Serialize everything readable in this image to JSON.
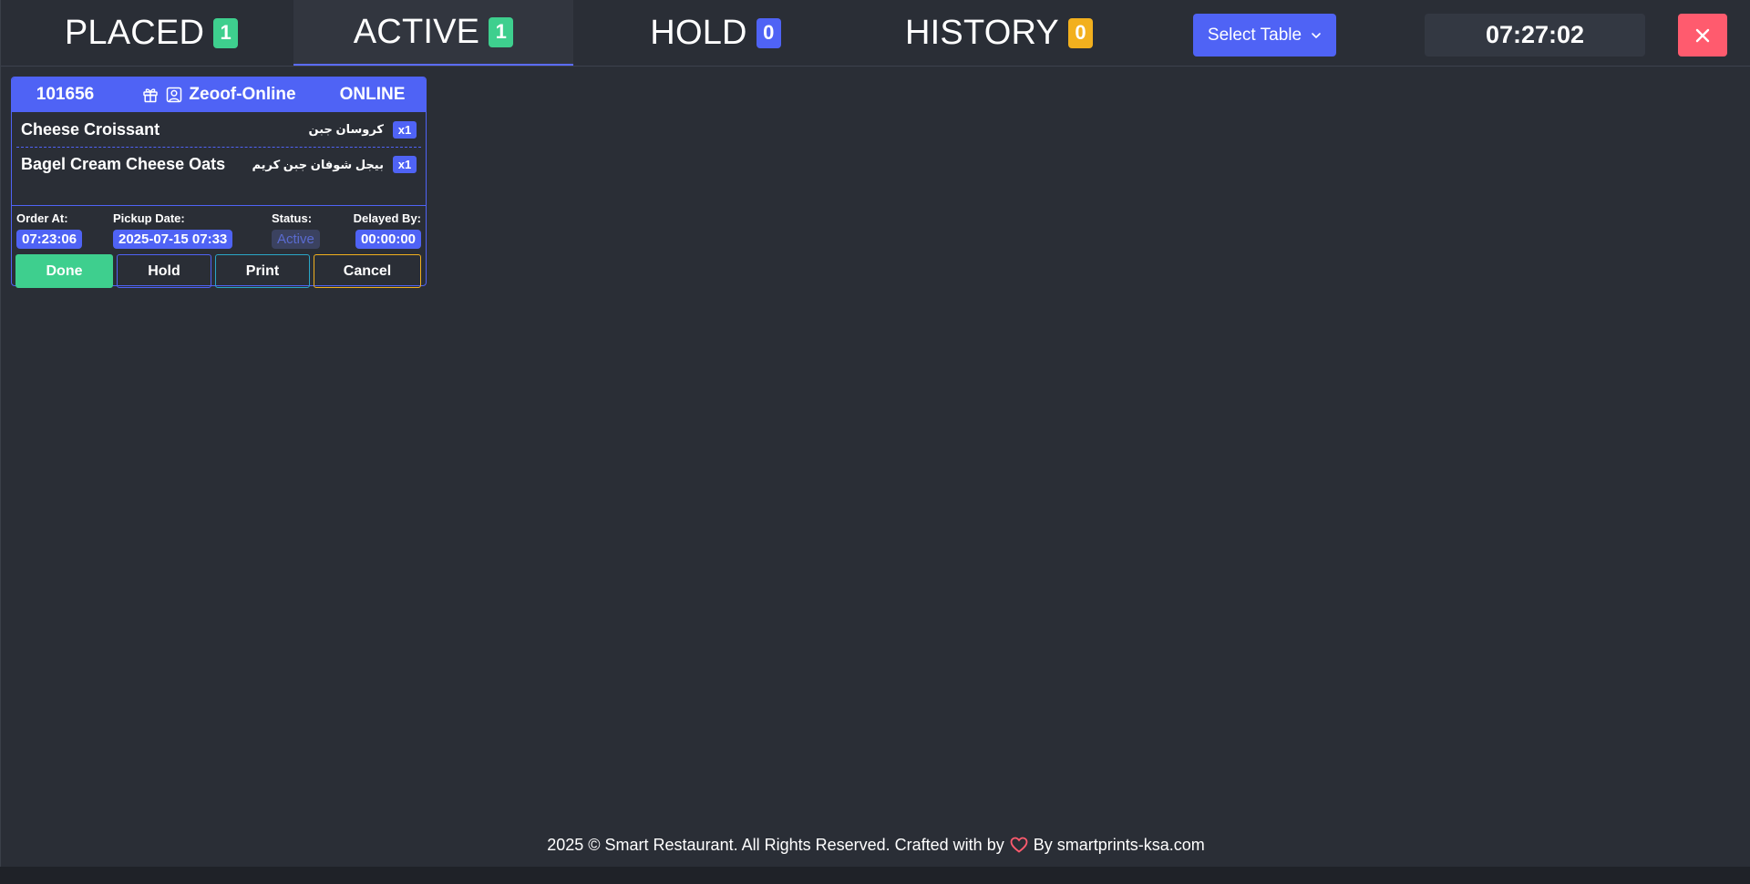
{
  "tabs": [
    {
      "label": "PLACED",
      "count": "1",
      "badge_color": "#3ecf8e"
    },
    {
      "label": "ACTIVE",
      "count": "1",
      "badge_color": "#3ecf8e"
    },
    {
      "label": "HOLD",
      "count": "0",
      "badge_color": "#4f63f5"
    },
    {
      "label": "HISTORY",
      "count": "0",
      "badge_color": "#f2b01e"
    }
  ],
  "active_tab": "ACTIVE",
  "select_table": {
    "label": "Select Table",
    "icon": "chevron-down-icon"
  },
  "clock": "07:27:02",
  "close_button": {
    "icon": "close-icon",
    "color": "#ff5b6e"
  },
  "order": {
    "id": "101656",
    "customer": "Zeoof-Online",
    "customer_icons": [
      "gift-icon",
      "user-square-icon"
    ],
    "channel": "ONLINE",
    "items": [
      {
        "name": "Cheese Croissant",
        "name_ar": "كروسان جبن",
        "qty": "x1"
      },
      {
        "name": "Bagel Cream Cheese Oats",
        "name_ar": "بيجل شوفان جبن كريم",
        "qty": "x1"
      }
    ],
    "meta": {
      "order_at_label": "Order At:",
      "order_at": "07:23:06",
      "pickup_label": "Pickup Date:",
      "pickup": "2025-07-15 07:33",
      "status_label": "Status:",
      "status": "Active",
      "delay_label": "Delayed By:",
      "delay": "00:00:00"
    },
    "actions": {
      "done": "Done",
      "hold": "Hold",
      "print": "Print",
      "cancel": "Cancel"
    }
  },
  "footer": {
    "prefix": "2025 © Smart Restaurant. All Rights Reserved. Crafted with by",
    "icon": "heart-icon",
    "suffix": "By smartprints-ksa.com"
  }
}
